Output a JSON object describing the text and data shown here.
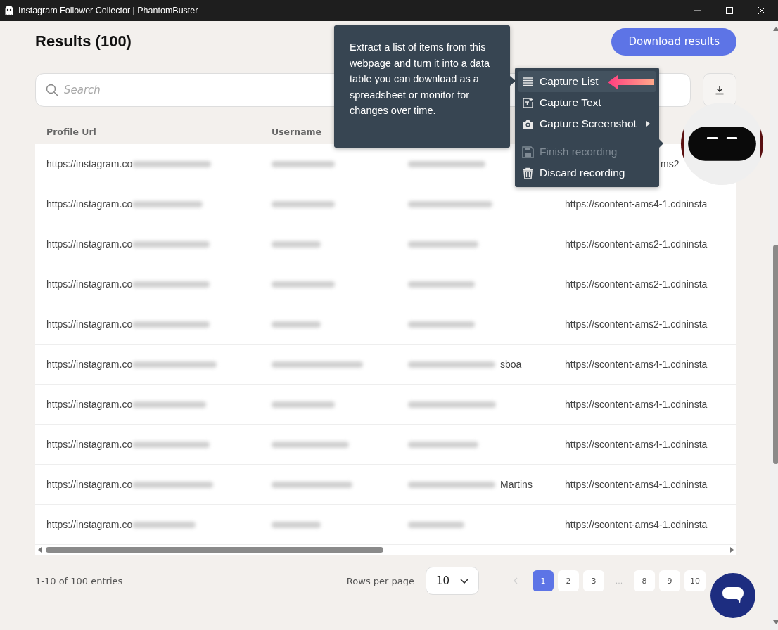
{
  "window": {
    "title": "Instagram Follower Collector | PhantomBuster"
  },
  "header": {
    "title": "Results (100)",
    "download_button": "Download results"
  },
  "search": {
    "placeholder": "Search"
  },
  "table": {
    "columns": [
      "Profile Url",
      "Username"
    ],
    "rows": [
      {
        "profile_url": "https://instagram.co",
        "column_4": "ms2",
        "column_4_partial": true
      },
      {
        "profile_url": "https://instagram.co",
        "column_4": "https://scontent-ams4-1.cdninsta"
      },
      {
        "profile_url": "https://instagram.co",
        "column_4": "https://scontent-ams2-1.cdninsta"
      },
      {
        "profile_url": "https://instagram.co",
        "column_4": "https://scontent-ams2-1.cdninsta"
      },
      {
        "profile_url": "https://instagram.co",
        "column_4": "https://scontent-ams2-1.cdninsta"
      },
      {
        "profile_url": "https://instagram.co",
        "column_3": "sboa",
        "column_4": "https://scontent-ams4-1.cdninsta"
      },
      {
        "profile_url": "https://instagram.co",
        "column_4": "https://scontent-ams4-1.cdninsta"
      },
      {
        "profile_url": "https://instagram.co",
        "column_4": "https://scontent-ams4-1.cdninsta"
      },
      {
        "profile_url": "https://instagram.co",
        "column_3": "Martins",
        "column_4": "https://scontent-ams4-1.cdninsta"
      },
      {
        "profile_url": "https://instagram.co",
        "column_4": "https://scontent-ams4-1.cdninsta"
      }
    ]
  },
  "footer": {
    "entries": "1-10 of 100 entries",
    "rows_per_page_label": "Rows per page",
    "rows_per_page": "10",
    "previous_disabled": true,
    "pages": [
      {
        "kind": "page",
        "label": "1",
        "selected": true
      },
      {
        "kind": "page",
        "label": "2",
        "selected": false
      },
      {
        "kind": "page",
        "label": "3",
        "selected": false
      },
      {
        "kind": "gap",
        "label": "..."
      },
      {
        "kind": "page",
        "label": "8",
        "selected": false
      },
      {
        "kind": "page",
        "label": "9",
        "selected": false
      },
      {
        "kind": "page",
        "label": "10",
        "selected": false
      }
    ]
  },
  "tooltip": {
    "text": "Extract a list of items from this webpage and turn it into a data table you can download as a spreadsheet or monitor for changes over time."
  },
  "menu": {
    "items": [
      {
        "label": "Capture List",
        "selected": true,
        "disabled": false,
        "submenu": false,
        "separator_before": false
      },
      {
        "label": "Capture Text",
        "selected": false,
        "disabled": false,
        "submenu": false,
        "separator_before": false
      },
      {
        "label": "Capture Screenshot",
        "selected": false,
        "disabled": false,
        "submenu": true,
        "separator_before": false
      },
      {
        "label": "Finish recording",
        "selected": false,
        "disabled": true,
        "submenu": false,
        "separator_before": true
      },
      {
        "label": "Discard recording",
        "selected": false,
        "disabled": false,
        "submenu": false,
        "separator_before": false
      }
    ]
  }
}
